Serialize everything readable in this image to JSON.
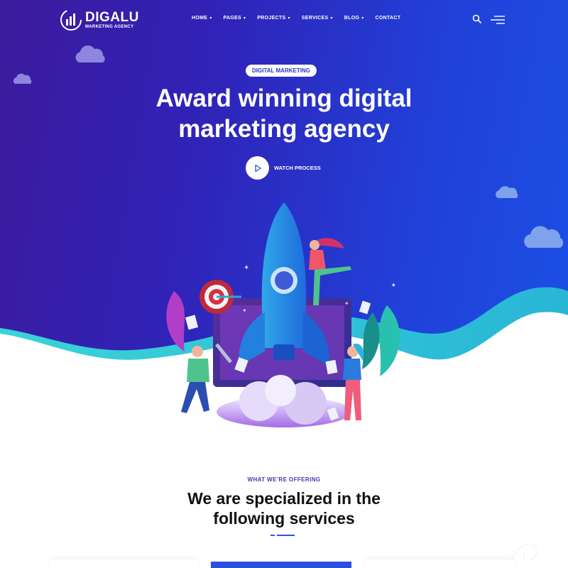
{
  "brand": {
    "name": "DIGALU",
    "tagline": "MARKETING AGENCY"
  },
  "nav": {
    "items": [
      {
        "label": "HOME",
        "has_dropdown": true
      },
      {
        "label": "PAGES",
        "has_dropdown": true
      },
      {
        "label": "PROJECTS",
        "has_dropdown": true
      },
      {
        "label": "SERVICES",
        "has_dropdown": true
      },
      {
        "label": "BLOG",
        "has_dropdown": true
      },
      {
        "label": "CONTACT",
        "has_dropdown": false
      }
    ],
    "icons": [
      "search-icon",
      "hamburger-menu-icon"
    ]
  },
  "hero": {
    "badge": "DIGITAL MARKETING",
    "headline_line1": "Award winning digital",
    "headline_line2": "marketing agency",
    "video_label": "WATCH PROCESS",
    "illustration": "rocket-launch-illustration"
  },
  "services": {
    "eyebrow": "WHAT WE’RE OFFERING",
    "title_line1": "We are specialized in the",
    "title_line2": "following services"
  },
  "colors": {
    "hero_gradient_start": "#3c1a9c",
    "hero_gradient_end": "#1b50e6",
    "wave_teal": "#2fc3d3",
    "accent_blue": "#2d54e6",
    "eyebrow_text": "#3f3ab0",
    "title_text": "#111111"
  }
}
